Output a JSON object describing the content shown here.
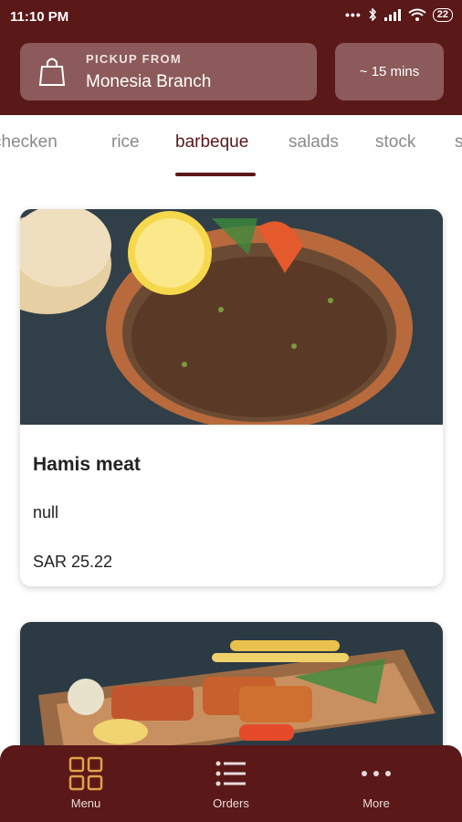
{
  "status_bar": {
    "time": "11:10 PM",
    "battery": "22"
  },
  "pickup": {
    "label": "PICKUP FROM",
    "branch": "Monesia Branch"
  },
  "eta": {
    "text": "~ 15 mins"
  },
  "categories": {
    "items": [
      "checken",
      "rice",
      "barbeque",
      "salads",
      "stock",
      "s"
    ],
    "active": "barbeque"
  },
  "menu_items": [
    {
      "name": "Hamis meat",
      "description": "null",
      "price": "SAR 25.22"
    }
  ],
  "bottom_nav": [
    {
      "label": "Menu",
      "icon": "grid-icon"
    },
    {
      "label": "Orders",
      "icon": "list-icon"
    },
    {
      "label": "More",
      "icon": "more-dots-icon"
    }
  ],
  "colors": {
    "brand": "#5a1818",
    "header_card": "#8c5a5a",
    "icon_accent": "#e0a24a"
  }
}
